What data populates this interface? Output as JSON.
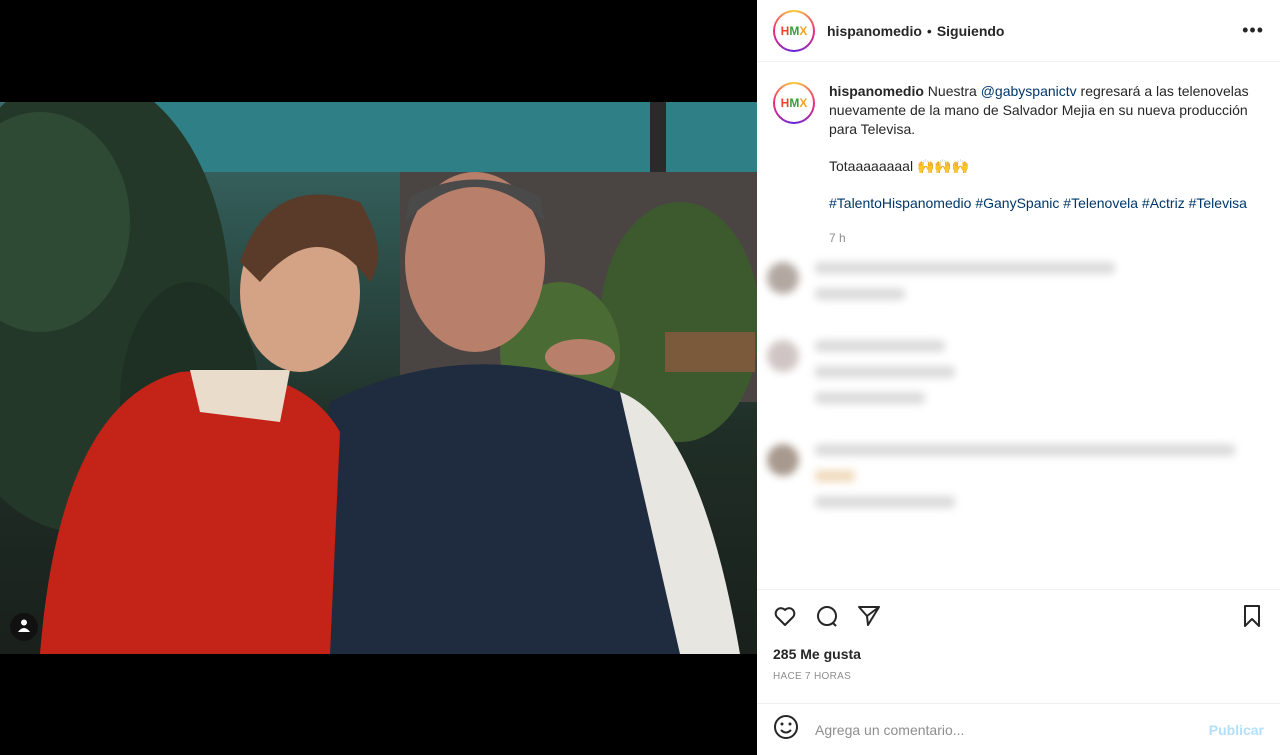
{
  "post": {
    "username": "hispanomedio",
    "follow_status": "Siguiendo",
    "separator": "•",
    "more_label": "•••",
    "avatar_letters": {
      "h": "H",
      "m": "M",
      "x": "X"
    }
  },
  "caption": {
    "username": "hispanomedio",
    "text_before": "Nuestra ",
    "mention": "@gabyspanictv",
    "text_after": " regresará a las telenovelas nuevamente de la mano de Salvador Mejia en su nueva producción para Televisa.",
    "line2": "Totaaaaaaaal 🙌🙌🙌",
    "hashtags": [
      "#TalentoHispanomedio",
      "#GanySpanic",
      "#Telenovela",
      "#Actriz",
      "#Televisa"
    ],
    "time": "7 h"
  },
  "stats": {
    "likes": "285 Me gusta",
    "posted_ago": "HACE 7 HORAS"
  },
  "comment_box": {
    "placeholder": "Agrega un comentario...",
    "publish_label": "Publicar"
  },
  "colors": {
    "link": "#00376b",
    "text": "#262626",
    "muted": "#8e8e8e",
    "publish_disabled": "#b2dffc"
  },
  "icons": [
    "heart-icon",
    "comment-icon",
    "share-icon",
    "bookmark-icon",
    "emoji-icon",
    "user-tag-icon"
  ]
}
